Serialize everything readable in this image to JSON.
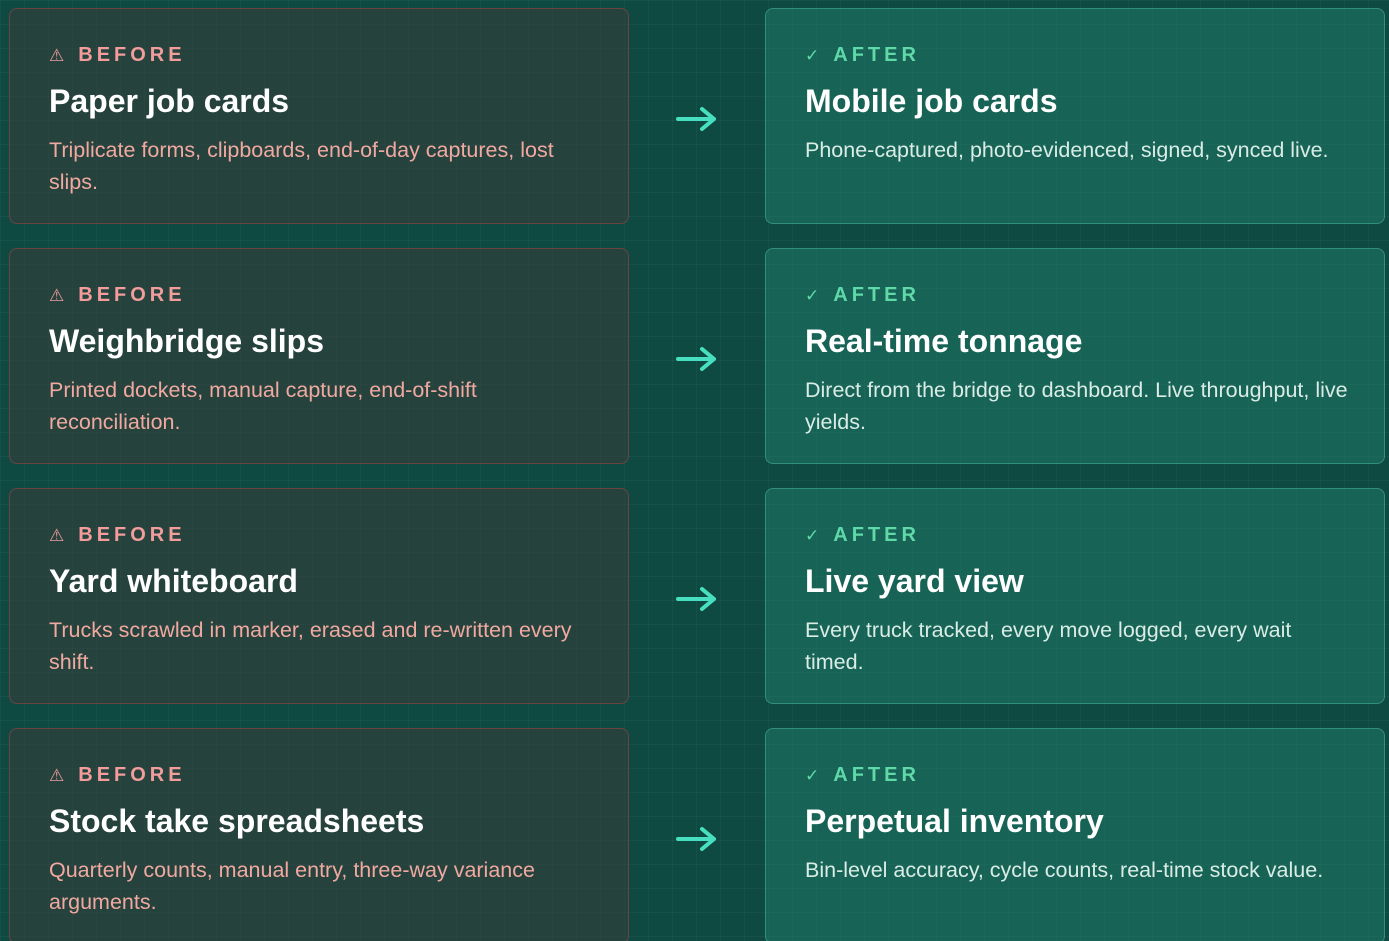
{
  "rows": [
    {
      "before": {
        "icon": "warning-icon",
        "tag": "BEFORE",
        "title": "Paper job cards",
        "description": "Triplicate forms, clipboards, end-of-day captures, lost slips."
      },
      "after": {
        "icon": "check-icon",
        "tag": "AFTER",
        "title": "Mobile job cards",
        "description": "Phone-captured, photo-evidenced, signed, synced live."
      }
    },
    {
      "before": {
        "icon": "warning-icon",
        "tag": "BEFORE",
        "title": "Weighbridge slips",
        "description": "Printed dockets, manual capture, end-of-shift reconciliation."
      },
      "after": {
        "icon": "check-icon",
        "tag": "AFTER",
        "title": "Real-time tonnage",
        "description": "Direct from the bridge to dashboard. Live throughput, live yields."
      }
    },
    {
      "before": {
        "icon": "warning-icon",
        "tag": "BEFORE",
        "title": "Yard whiteboard",
        "description": "Trucks scrawled in marker, erased and re-written every shift."
      },
      "after": {
        "icon": "check-icon",
        "tag": "AFTER",
        "title": "Live yard view",
        "description": "Every truck tracked, every move logged, every wait timed."
      }
    },
    {
      "before": {
        "icon": "warning-icon",
        "tag": "BEFORE",
        "title": "Stock take spreadsheets",
        "description": "Quarterly counts, manual entry, three-way variance arguments."
      },
      "after": {
        "icon": "check-icon",
        "tag": "AFTER",
        "title": "Perpetual inventory",
        "description": "Bin-level accuracy, cycle counts, real-time stock value."
      }
    }
  ],
  "colors": {
    "background": "#0f4a42",
    "before_accent": "#f29c9c",
    "after_accent": "#5fd9a8",
    "arrow": "#46e0c0"
  }
}
